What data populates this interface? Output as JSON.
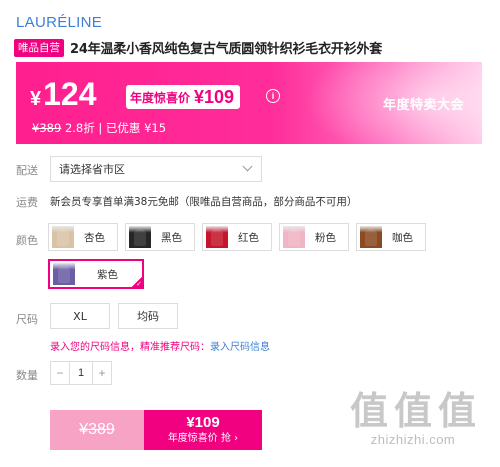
{
  "brand": "LAURÉLINE",
  "product": {
    "badge": "唯品自营",
    "title": "24年温柔小香风纯色复古气质圆领针织衫毛衣开衫外套"
  },
  "price_banner": {
    "currency": "¥",
    "price": "124",
    "promo_label": "年度惊喜价",
    "promo_price": "¥109",
    "info_icon": "i",
    "original_price": "¥389",
    "discount_text": "2.8折 | 已优惠 ¥15",
    "event_label": "年度特卖大会"
  },
  "delivery": {
    "label": "配送",
    "placeholder": "请选择省市区"
  },
  "shipping": {
    "label": "运费",
    "text": "新会员专享首单满38元免邮（限唯品自营商品，部分商品不可用）"
  },
  "colors": {
    "label": "颜色",
    "options": [
      {
        "name": "杏色",
        "swatch": "#d9c3a5"
      },
      {
        "name": "黑色",
        "swatch": "#262626"
      },
      {
        "name": "红色",
        "swatch": "#c4172c"
      },
      {
        "name": "粉色",
        "swatch": "#f0b4c4"
      },
      {
        "name": "咖色",
        "swatch": "#8a4a22"
      },
      {
        "name": "紫色",
        "swatch": "#6b5ea6"
      }
    ],
    "selected": "紫色",
    "check_mark": "✓"
  },
  "sizes": {
    "label": "尺码",
    "options": [
      "XL",
      "均码"
    ]
  },
  "size_hint": {
    "text": "录入您的尺码信息，精准推荐尺码：",
    "link": "录入尺码信息"
  },
  "quantity": {
    "label": "数量",
    "minus": "−",
    "value": "1",
    "plus": "+"
  },
  "buy": {
    "original": "¥389",
    "price": "¥109",
    "action": "年度惊喜价 抢 ›"
  },
  "watermark": {
    "chars": [
      "值",
      "值",
      "值"
    ],
    "url": "zhizhizhi.com"
  }
}
